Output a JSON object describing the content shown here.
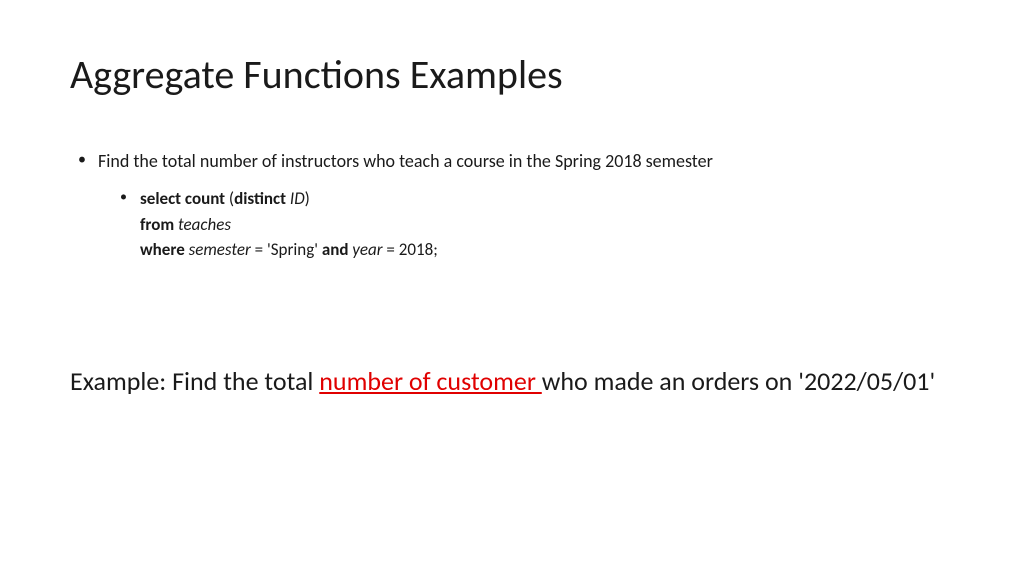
{
  "title": "Aggregate Functions Examples",
  "bullet1": {
    "text": "Find the total number of instructors who teach a course in the Spring 2018 semester",
    "sql": {
      "line1_kw1": "select count",
      "line1_paren_open": " (",
      "line1_kw2": "distinct",
      "line1_italic": " ID",
      "line1_paren_close": ")",
      "line2_kw": "from",
      "line2_italic": " teaches",
      "line3_kw1": "where",
      "line3_italic1": " semester",
      "line3_text1": " = 'Spring' ",
      "line3_kw2": "and",
      "line3_italic2": " year",
      "line3_text2": " = 2018;"
    }
  },
  "example": {
    "prefix": "Example: Find the total ",
    "highlighted": "number of customer ",
    "suffix": "who made an orders on '2022/05/01'"
  }
}
